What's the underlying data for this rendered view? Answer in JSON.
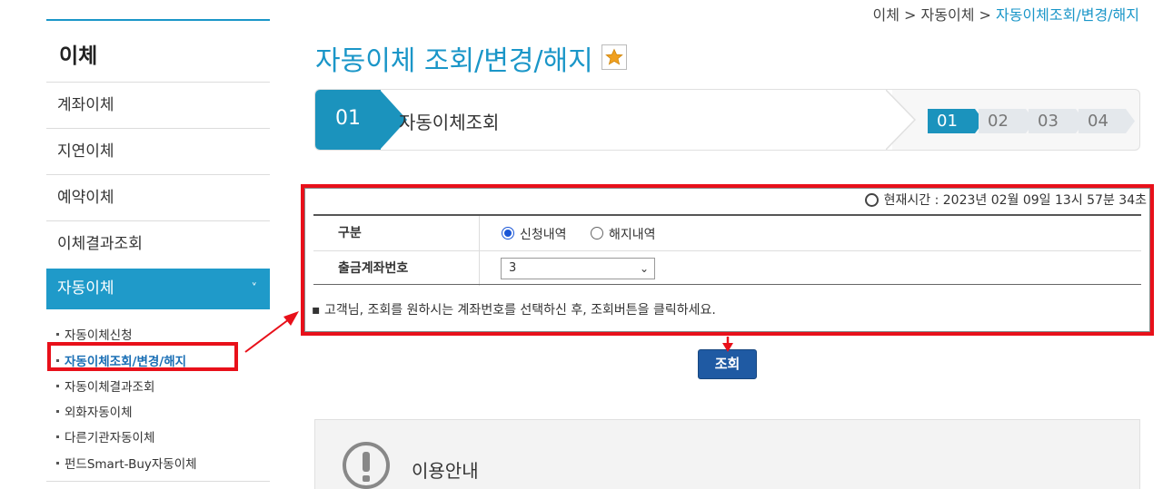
{
  "breadcrumb": {
    "item1": "이체",
    "sep": " > ",
    "item2": "자동이체",
    "current": "자동이체조회/변경/해지"
  },
  "sidebar": {
    "title": "이체",
    "items": [
      {
        "label": "계좌이체"
      },
      {
        "label": "지연이체"
      },
      {
        "label": "예약이체"
      },
      {
        "label": "이체결과조회"
      },
      {
        "label": "자동이체"
      }
    ],
    "subitems": [
      {
        "label": "자동이체신청"
      },
      {
        "label": "자동이체조회/변경/해지"
      },
      {
        "label": "자동이체결과조회"
      },
      {
        "label": "외화자동이체"
      },
      {
        "label": "다른기관자동이체"
      },
      {
        "label": "펀드Smart-Buy자동이체"
      }
    ],
    "chevron": "˅"
  },
  "page": {
    "title": "자동이체 조회/변경/해지"
  },
  "stepbar": {
    "current_num": "01",
    "current_label": "자동이체조회",
    "steps": [
      "01",
      "02",
      "03",
      "04"
    ]
  },
  "form": {
    "time_text": "현재시간 : 2023년 02월 09일 13시 57분 34초",
    "row1_label": "구분",
    "radio1": "신청내역",
    "radio2": "해지내역",
    "row2_label": "출금계좌번호",
    "account_value": "3",
    "note": "고객님, 조회를 원하시는 계좌번호를 선택하신 후, 조회버튼을 클릭하세요."
  },
  "buttons": {
    "search": "조회"
  },
  "info": {
    "title": "이용안내"
  },
  "colors": {
    "accent": "#1a96c8",
    "highlight": "#e8101a",
    "button": "#1f5aa3"
  }
}
